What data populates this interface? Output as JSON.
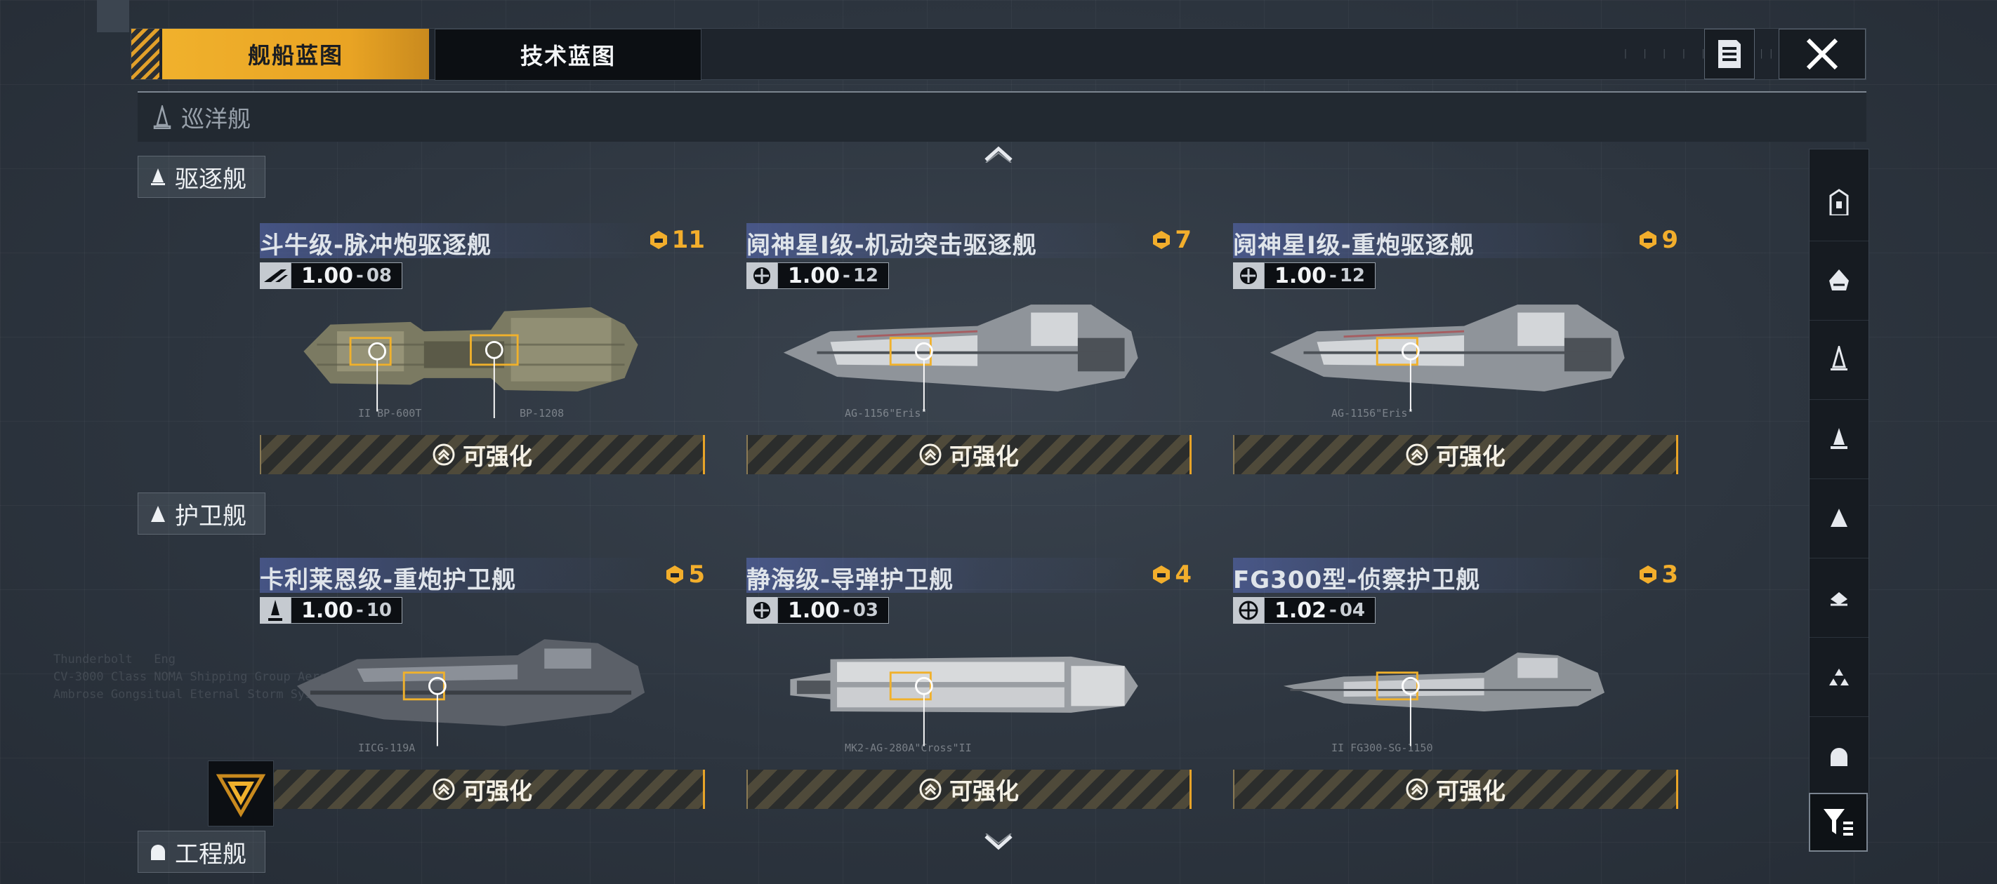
{
  "tabs": [
    {
      "label": "舰船蓝图",
      "active": true
    },
    {
      "label": "技术蓝图",
      "active": false
    }
  ],
  "header_icons": {
    "notes": "notes-icon",
    "close": "close-icon"
  },
  "category_header": {
    "label": "巡洋舰",
    "icon": "cruiser-icon"
  },
  "sections": [
    {
      "label": "驱逐舰",
      "icon": "destroyer-icon",
      "cards": [
        {
          "name": "斗牛级-脉冲炮驱逐舰",
          "count": "11",
          "version": "1.00",
          "version_minor": "08",
          "enhance_label": "可强化",
          "ship_tags": [
            "II BP-600T",
            "BP-1208"
          ]
        },
        {
          "name": "阋神星I级-机动突击驱逐舰",
          "count": "7",
          "version": "1.00",
          "version_minor": "12",
          "enhance_label": "可强化",
          "ship_tags": [
            "AG-1156\"Eris\""
          ]
        },
        {
          "name": "阋神星I级-重炮驱逐舰",
          "count": "9",
          "version": "1.00",
          "version_minor": "12",
          "enhance_label": "可强化",
          "ship_tags": [
            "AG-1156\"Eris\""
          ]
        }
      ]
    },
    {
      "label": "护卫舰",
      "icon": "frigate-icon",
      "cards": [
        {
          "name": "卡利莱恩级-重炮护卫舰",
          "count": "5",
          "version": "1.00",
          "version_minor": "10",
          "enhance_label": "可强化",
          "ship_tags": [
            "IICG-119A"
          ]
        },
        {
          "name": "静海级-导弹护卫舰",
          "count": "4",
          "version": "1.00",
          "version_minor": "03",
          "enhance_label": "可强化",
          "ship_tags": [
            "MK2-AG-280A\"Cross\"II"
          ]
        },
        {
          "name": "FG300型-侦察护卫舰",
          "count": "3",
          "version": "1.02",
          "version_minor": "04",
          "enhance_label": "可强化",
          "ship_tags": [
            "II FG300-SG-1150"
          ]
        }
      ]
    }
  ],
  "bottom_category": {
    "label": "工程舰",
    "icon": "engineering-ship-icon"
  },
  "rail_items": [
    {
      "name": "carrier",
      "icon": "carrier-class-icon"
    },
    {
      "name": "battleship",
      "icon": "battleship-class-icon"
    },
    {
      "name": "cruiser",
      "icon": "cruiser-class-icon"
    },
    {
      "name": "destroyer",
      "icon": "destroyer-class-icon"
    },
    {
      "name": "frigate",
      "icon": "frigate-class-icon"
    },
    {
      "name": "corvette",
      "icon": "corvette-class-icon"
    },
    {
      "name": "fighter",
      "icon": "fighter-class-icon"
    },
    {
      "name": "engineering",
      "icon": "engineering-class-icon"
    }
  ],
  "deco_text": "Thunderbolt   Eng\nCV-3000 Class NOMA Shipping Group Aeronau\nAmbrose Gongsitual Eternal Storm Syste",
  "colors": {
    "accent": "#f0b12c",
    "background": "#2b333d",
    "highlight_blue": "#5a6ebe"
  }
}
